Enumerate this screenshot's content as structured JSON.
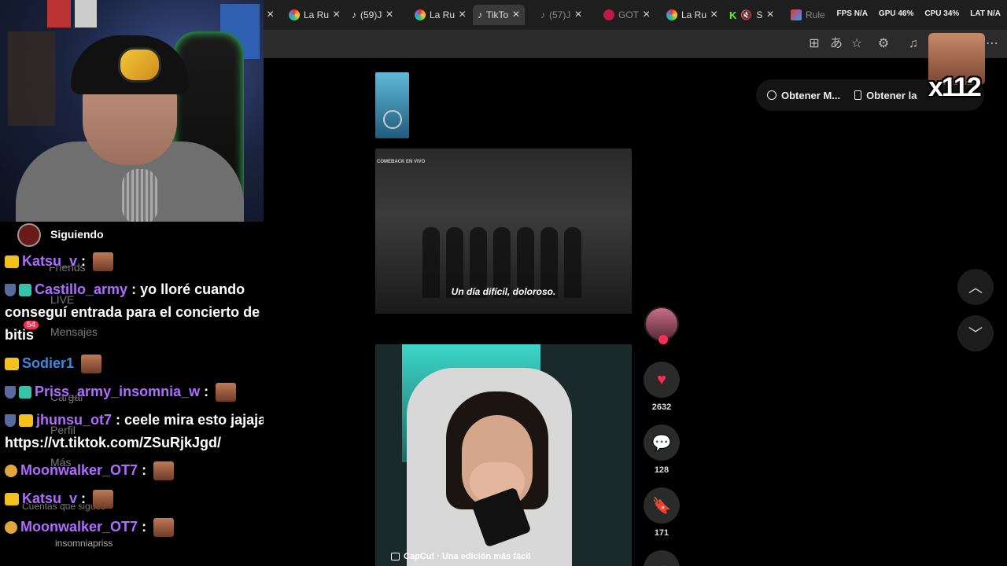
{
  "chat": {
    "ghost_nav": [
      "Friends",
      "LIVE",
      "Mensajes",
      "Cargar",
      "Perfil",
      "Más",
      "Cuentas que sigues",
      "insomniapriss"
    ],
    "following_label": "Siguiendo",
    "notif_count": "54",
    "messages": [
      {
        "user": "Katsu_v",
        "sep": ":",
        "text": ""
      },
      {
        "user": "Castillo_army",
        "sep": ":",
        "text": "yo lloré cuando conseguí entrada para el concierto de los bitis"
      },
      {
        "user": "Sodier1",
        "sep": ":",
        "text": ""
      },
      {
        "user": "Priss_army_insomnia_w",
        "sep": ":",
        "text": ""
      },
      {
        "user": "jhunsu_ot7",
        "sep": ":",
        "text": "ceele mira esto jajajaj: https://vt.tiktok.com/ZSuRjkJgd/"
      },
      {
        "user": "Moonwalker_OT7",
        "sep": ":",
        "text": ""
      },
      {
        "user": "Katsu_v",
        "sep": ":",
        "text": ""
      },
      {
        "user": "Moonwalker_OT7",
        "sep": ":",
        "text": ""
      }
    ]
  },
  "browser": {
    "tabs": [
      "La Ru",
      "(59)J",
      "La Ru",
      "TikTo",
      "(57)J",
      "GOT",
      "La Ru",
      "S",
      "Rule"
    ],
    "stats": [
      "FPS N/A",
      "GPU 46%",
      "CPU 34%",
      "LAT N/A"
    ]
  },
  "tiktok": {
    "video1_tag": "COMEBACK EN VIVO",
    "subtitle": "Un día difícil, doloroso.",
    "capcut_label": "CapCut · Una edición más fácil",
    "likes": "2632",
    "comments": "128",
    "saves": "171",
    "pill_get_coins": "Obtener M...",
    "pill_get_app": "Obtener la",
    "overlay_count": "x112"
  }
}
